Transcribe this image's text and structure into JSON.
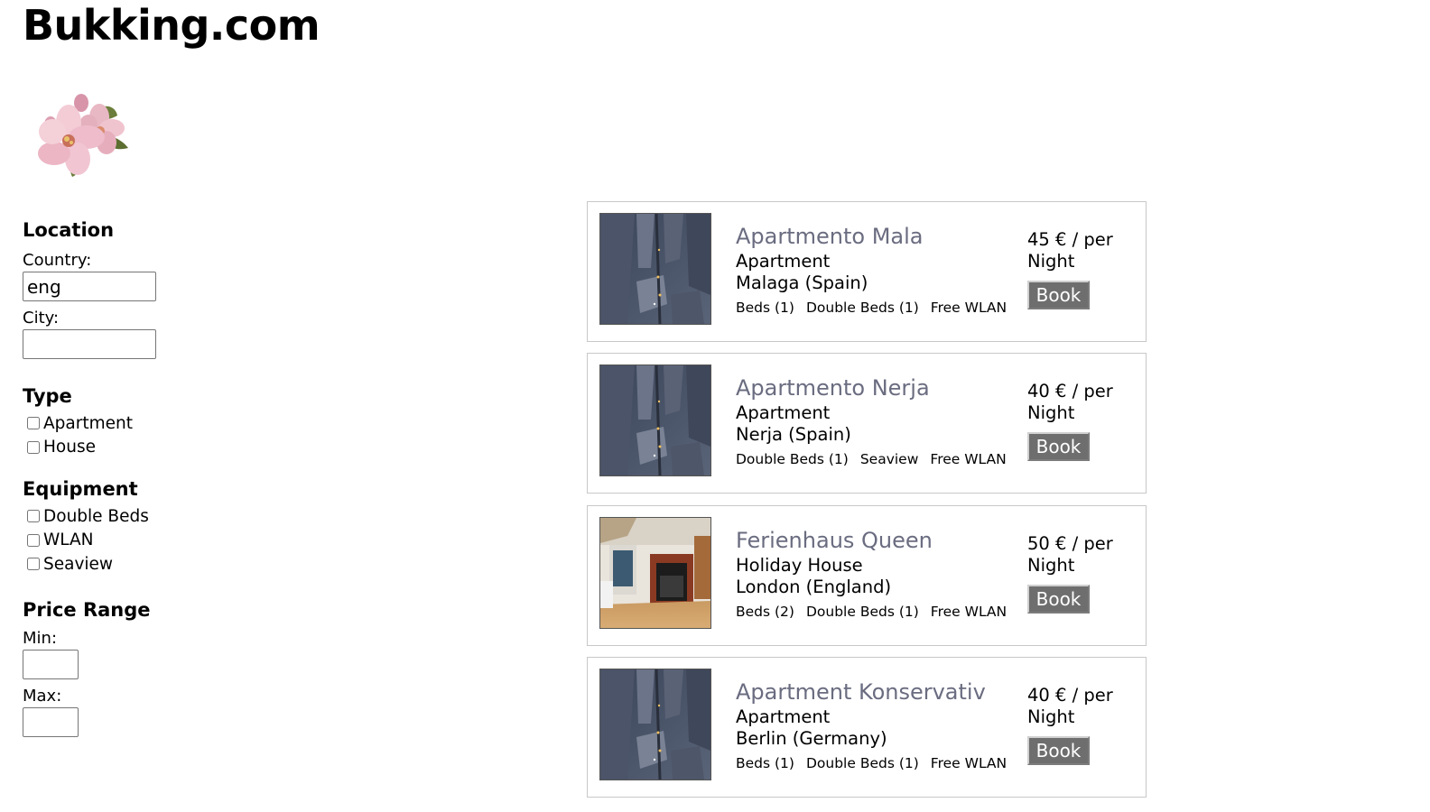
{
  "site": {
    "title": "Bukking.com",
    "logo_icon": "cherry-blossom-flower-icon"
  },
  "filters": {
    "location": {
      "heading": "Location",
      "country_label": "Country:",
      "country_value": "eng",
      "city_label": "City:",
      "city_value": ""
    },
    "type": {
      "heading": "Type",
      "options": [
        {
          "label": "Apartment",
          "checked": false
        },
        {
          "label": "House",
          "checked": false
        }
      ]
    },
    "equipment": {
      "heading": "Equipment",
      "options": [
        {
          "label": "Double Beds",
          "checked": false
        },
        {
          "label": "WLAN",
          "checked": false
        },
        {
          "label": "Seaview",
          "checked": false
        }
      ]
    },
    "price_range": {
      "heading": "Price Range",
      "min_label": "Min:",
      "min_value": "",
      "max_label": "Max:",
      "max_value": ""
    }
  },
  "listings": [
    {
      "name": "Apartmento Mala",
      "type": "Apartment",
      "location": "Malaga (Spain)",
      "features": [
        "Beds (1)",
        "Double Beds (1)",
        "Free WLAN"
      ],
      "price": "45 € / per Night",
      "book_label": "Book",
      "image": "city-aerial-photo"
    },
    {
      "name": "Apartmento Nerja",
      "type": "Apartment",
      "location": "Nerja (Spain)",
      "features": [
        "Double Beds (1)",
        "Seaview",
        "Free WLAN"
      ],
      "price": "40 € / per Night",
      "book_label": "Book",
      "image": "city-aerial-photo"
    },
    {
      "name": "Ferienhaus Queen",
      "type": "Holiday House",
      "location": "London (England)",
      "features": [
        "Beds (2)",
        "Double Beds (1)",
        "Free WLAN"
      ],
      "price": "50 € / per Night",
      "book_label": "Book",
      "image": "living-room-fireplace-photo"
    },
    {
      "name": "Apartment Konservativ",
      "type": "Apartment",
      "location": "Berlin (Germany)",
      "features": [
        "Beds (1)",
        "Double Beds (1)",
        "Free WLAN"
      ],
      "price": "40 € / per Night",
      "book_label": "Book",
      "image": "city-aerial-photo"
    }
  ],
  "colors": {
    "listing_name": "#6a6c80",
    "book_button": "#6e6e6e",
    "card_border": "#c8c8c8"
  }
}
